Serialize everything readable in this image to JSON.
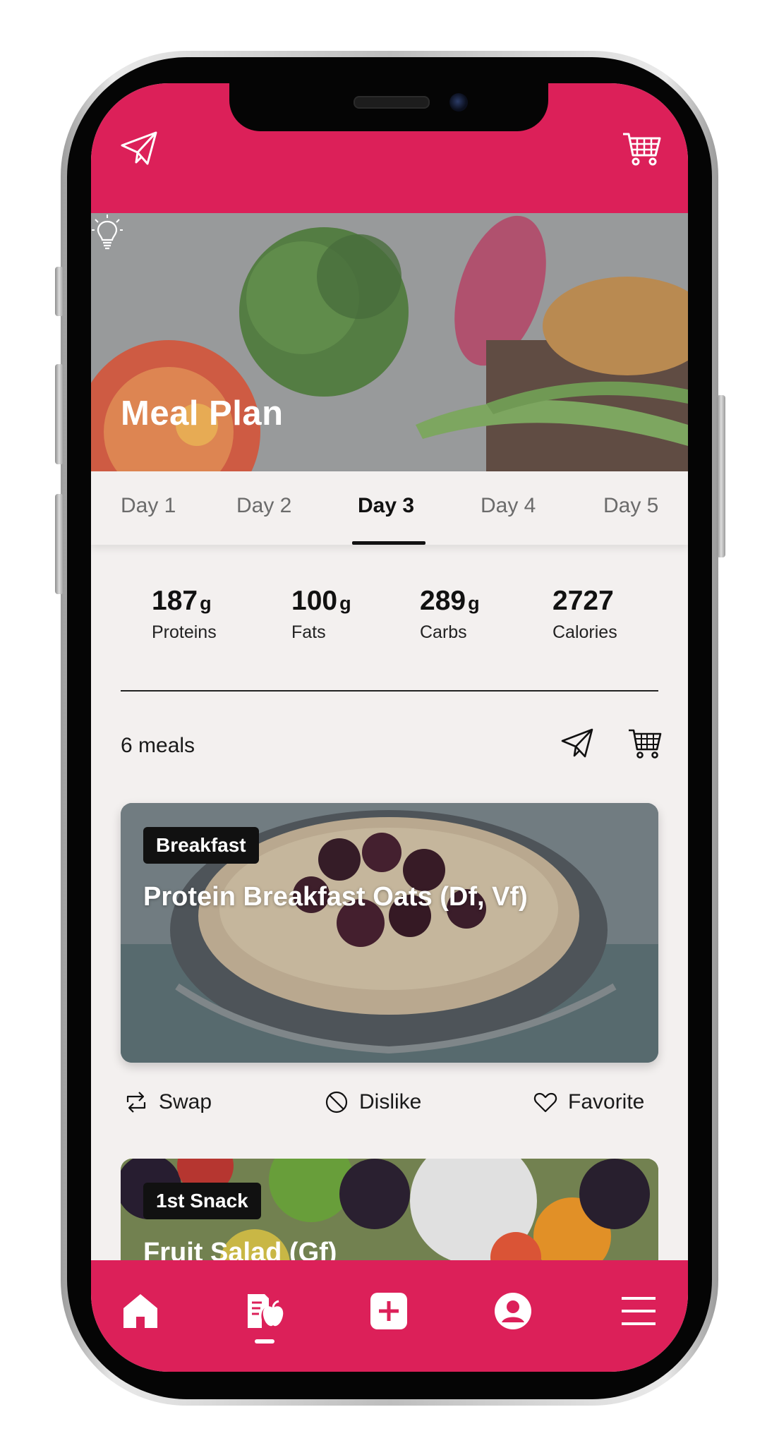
{
  "colors": {
    "brand": "#dc2059",
    "background": "#f3f0ef",
    "text": "#111111",
    "muted": "#6b6b6b"
  },
  "header": {
    "left_icon": "paper-plane-icon",
    "right_icon": "shopping-cart-icon"
  },
  "hero": {
    "title": "Meal Plan",
    "icon": "lightbulb-icon"
  },
  "tabs": [
    {
      "label": "Day 1",
      "active": false
    },
    {
      "label": "Day 2",
      "active": false
    },
    {
      "label": "Day 3",
      "active": true
    },
    {
      "label": "Day 4",
      "active": false
    },
    {
      "label": "Day 5",
      "active": false
    }
  ],
  "macros": [
    {
      "value": "187",
      "unit": "g",
      "label": "Proteins"
    },
    {
      "value": "100",
      "unit": "g",
      "label": "Fats"
    },
    {
      "value": "289",
      "unit": "g",
      "label": "Carbs"
    },
    {
      "value": "2727",
      "unit": "",
      "label": "Calories"
    }
  ],
  "meals_summary": {
    "count_text": "6 meals",
    "share_icon": "paper-plane-icon",
    "cart_icon": "shopping-cart-icon"
  },
  "meals": [
    {
      "badge": "Breakfast",
      "title": "Protein Breakfast Oats (Df, Vf)",
      "actions": [
        {
          "label": "Swap",
          "icon": "swap-icon"
        },
        {
          "label": "Dislike",
          "icon": "block-icon"
        },
        {
          "label": "Favorite",
          "icon": "heart-icon"
        }
      ]
    },
    {
      "badge": "1st Snack",
      "title": "Fruit Salad (Gf)"
    }
  ],
  "bottom_nav": [
    {
      "name": "home",
      "icon": "home-icon"
    },
    {
      "name": "meal-plan",
      "icon": "meal-plan-icon",
      "active": true
    },
    {
      "name": "add",
      "icon": "plus-square-icon"
    },
    {
      "name": "profile",
      "icon": "user-circle-icon"
    },
    {
      "name": "menu",
      "icon": "hamburger-menu-icon"
    }
  ]
}
